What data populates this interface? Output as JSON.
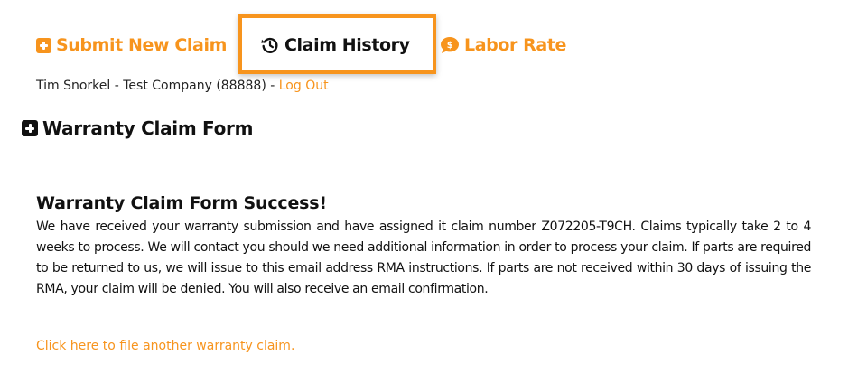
{
  "nav": {
    "submit_label": "Submit New Claim",
    "history_label": "Claim History",
    "labor_label": "Labor Rate"
  },
  "user": {
    "info": "Tim Snorkel - Test Company (88888) - ",
    "logout_label": "Log Out"
  },
  "form": {
    "heading": "Warranty Claim Form"
  },
  "success": {
    "title": "Warranty Claim Form Success!",
    "body": "We have received your warranty submission and have assigned it claim number Z072205-T9CH. Claims typically take 2 to 4 weeks to process. We will contact you should we need additional information in order to process your claim. If parts are required to be returned to us, we will issue to this email address RMA instructions. If parts are not received within 30 days of issuing the RMA, your claim will be denied. You will also receive an email confirmation.",
    "file_another_label": "Click here to file another warranty claim."
  },
  "colors": {
    "accent": "#f7941d",
    "text": "#111111"
  },
  "icons": {
    "submit": "plus-square-icon",
    "history": "history-clock-icon",
    "labor": "dollar-chat-icon",
    "form": "plus-square-icon"
  }
}
